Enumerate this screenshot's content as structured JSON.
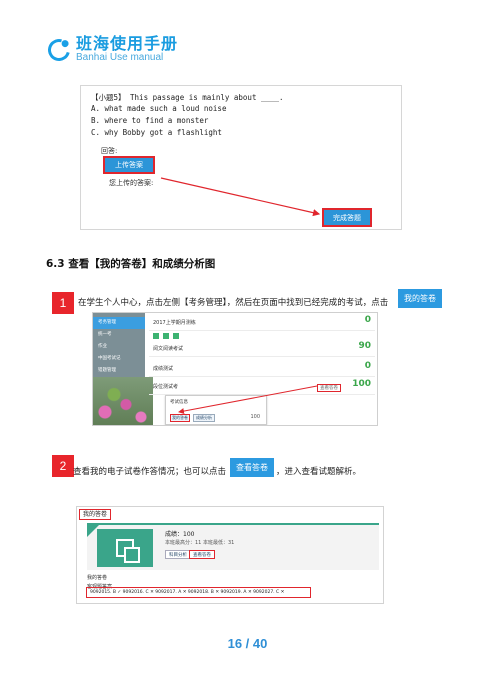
{
  "header": {
    "logo_cn": "班海使用手册",
    "logo_en": "Banhai Use manual"
  },
  "question_panel": {
    "question": "【小题5】 This passage is mainly about ____.",
    "options": [
      "A. what made such a loud noise",
      "B. where to find a monster",
      "C. why Bobby got a flashlight"
    ],
    "answer_label": "回答:",
    "upload_button": "上传答案",
    "uploaded_label": "您上传的答案:",
    "complete_button": "完成答题"
  },
  "section": {
    "title": "6.3  查看【我的答卷】和成绩分析图"
  },
  "step1": {
    "number": "1",
    "text": "在学生个人中心，点击左侧【考务管理】，然后在页面中找到已经完成的考试，点击",
    "button": "我的答卷"
  },
  "exam_list": {
    "sidebar": [
      "考务管理",
      "统一考",
      "作业",
      "中国考试记",
      "错题管理"
    ],
    "rows": [
      {
        "name": "2017上学期月测练",
        "status": "",
        "score": "0"
      },
      {
        "name": "阅文阅读考试",
        "status": "",
        "score": "90"
      },
      {
        "name": "成绩测试",
        "status": "",
        "score": "0"
      },
      {
        "name": "段位测试考",
        "status": "查看答卷",
        "score": "100"
      }
    ],
    "popup_title": "考试信息",
    "popup_btn1": "我的答卷",
    "popup_btn2": "成绩分析",
    "popup_value": "100"
  },
  "step2": {
    "number": "2",
    "text_before": "查看我的电子试卷作答情况；也可以点击",
    "button": "查看答卷",
    "text_after": "，进入查看试题解析。"
  },
  "answer_sheet": {
    "title": "我的答卷",
    "score": "成绩：100",
    "line1": "本班最高分：11    本班最低：31",
    "btn1": "科目分析",
    "btn2": "查看答卷",
    "my_answers": "我的答卷",
    "wrong_title": "客观题答案",
    "answers": "9092015. B ✓  9092016. C ✕  9092017. A ✕  9092018. B ✕  9092019. A ✕  9092027. C ✕"
  },
  "footer": {
    "page": "16 / 40"
  },
  "colors": {
    "accent": "#2c9ae0",
    "highlight": "#e0262d",
    "brand": "#1a9ce0",
    "score_green": "#3aa64a"
  }
}
